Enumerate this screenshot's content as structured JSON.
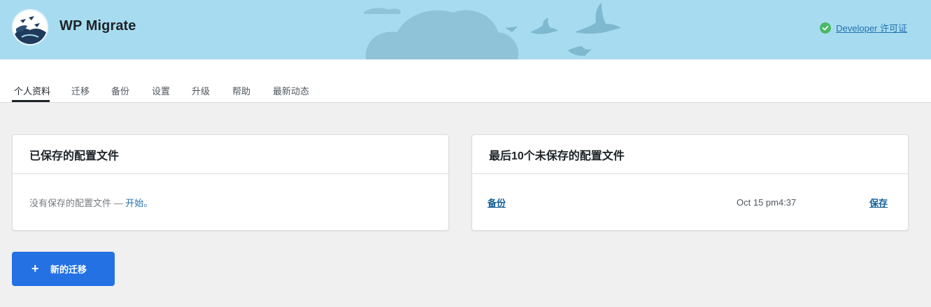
{
  "app": {
    "title": "WP Migrate"
  },
  "license": {
    "label": "Developer 许可证",
    "icon": "check-circle-icon",
    "color": "#4ab866"
  },
  "nav": {
    "tabs": [
      {
        "label": "个人资料",
        "active": true
      },
      {
        "label": "迁移"
      },
      {
        "label": "备份"
      },
      {
        "label": "设置"
      },
      {
        "label": "升级"
      },
      {
        "label": "帮助"
      },
      {
        "label": "最新动态"
      }
    ]
  },
  "saved_profiles": {
    "title": "已保存的配置文件",
    "empty_text": "没有保存的配置文件 — ",
    "empty_link": "开始。"
  },
  "unsaved_profiles": {
    "title": "最后10个未保存的配置文件",
    "rows": [
      {
        "name": "备份",
        "date": "Oct 15 pm4:37",
        "action": "保存"
      }
    ]
  },
  "new_migration_button": {
    "icon": "plus-icon",
    "label": "新的迁移"
  },
  "colors": {
    "banner": "#a7dcf0",
    "primary_button": "#2371e3",
    "link": "#2271b1"
  }
}
